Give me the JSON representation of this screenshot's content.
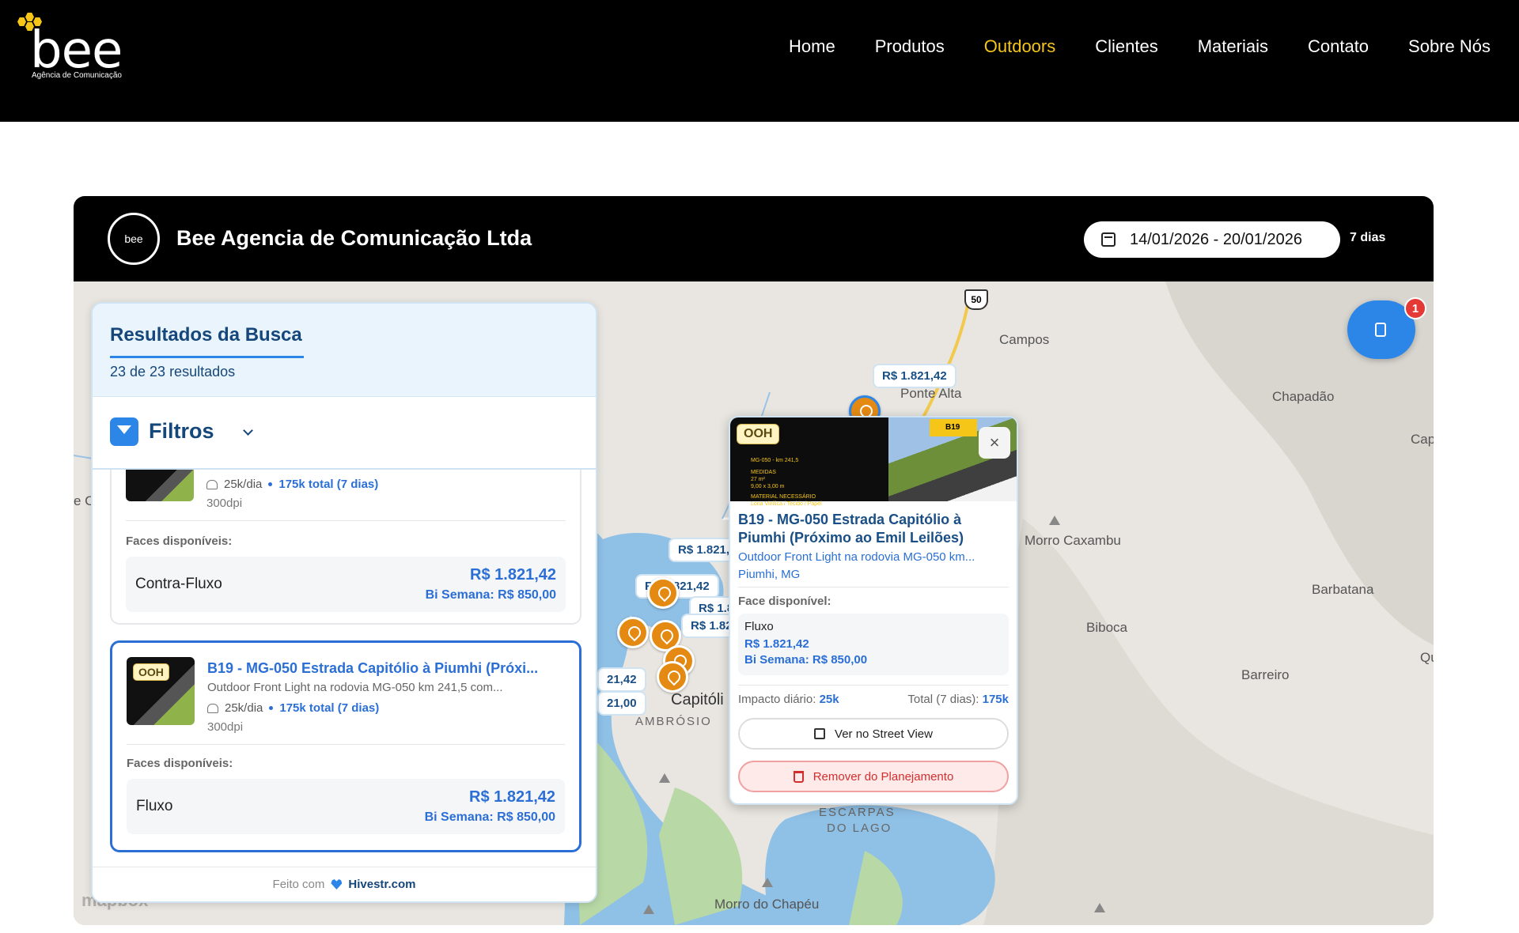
{
  "nav": {
    "brand_word": "bee",
    "brand_tagline": "Agência de Comunicação",
    "items": [
      {
        "label": "Home",
        "active": false
      },
      {
        "label": "Produtos",
        "active": false
      },
      {
        "label": "Outdoors",
        "active": true
      },
      {
        "label": "Clientes",
        "active": false
      },
      {
        "label": "Materiais",
        "active": false
      },
      {
        "label": "Contato",
        "active": false
      },
      {
        "label": "Sobre Nós",
        "active": false
      }
    ],
    "accent_color": "#f5c518"
  },
  "panel": {
    "logo_text": "bee",
    "company": "Bee Agencia de Comunicação Ltda",
    "date_range": "14/01/2026 - 20/01/2026",
    "days": "7 dias"
  },
  "map": {
    "places": {
      "campos": "Campos",
      "ponte_alta": "Ponte Alta",
      "chapadao": "Chapadão",
      "cap": "Cap",
      "morro_caxambu": "Morro Caxambu",
      "barbatana": "Barbatana",
      "biboca": "Biboca",
      "barreiro": "Barreiro",
      "qu": "Qu",
      "capitolio": "Capitóli",
      "ambrosio": "AMBRÓSIO",
      "escarpas": "ESCARPAS",
      "do_lago": "DO LAGO",
      "morro_chapeu": "Morro do Chapéu",
      "ec": "e C"
    },
    "highway": "50",
    "price_tags": [
      "R$ 1.821,42",
      "R$ 1.821,",
      "R$ 1.821,42",
      "R$ 1.8",
      "R$ 1.82",
      "21,42",
      "21,00"
    ],
    "attribution": "mapbox",
    "plan_badge_count": "1"
  },
  "results": {
    "title": "Resultados da Busca",
    "count": "23 de 23 resultados",
    "filters_label": "Filtros",
    "card1": {
      "audience": "25k/dia",
      "total": "175k total (7 dias)",
      "dpi": "300dpi",
      "faces_label": "Faces disponíveis:",
      "face_name": "Contra-Fluxo",
      "face_price": "R$ 1.821,42",
      "face_bi": "Bi Semana: R$ 850,00"
    },
    "card2": {
      "chip": "OOH",
      "title": "B19 - MG-050 Estrada Capitólio à Piumhi (Próxi...",
      "subtitle": "Outdoor Front Light na rodovia MG-050 km 241,5 com...",
      "audience": "25k/dia",
      "total": "175k total (7 dias)",
      "dpi": "300dpi",
      "faces_label": "Faces disponíveis:",
      "face_name": "Fluxo",
      "face_price": "R$ 1.821,42",
      "face_bi": "Bi Semana: R$ 850,00"
    },
    "footer_made": "Feito com",
    "footer_site": "Hivestr.com"
  },
  "popup": {
    "chip": "OOH",
    "title": "B19 - MG-050 Estrada Capitólio à Piumhi (Próximo ao Emil Leilões)",
    "subtitle": "Outdoor Front Light na rodovia MG-050 km...",
    "city": "Piumhi, MG",
    "face_label": "Face disponível:",
    "face_name": "Fluxo",
    "face_price": "R$ 1.821,42",
    "face_bi": "Bi Semana: R$ 850,00",
    "impact_label": "Impacto diário:",
    "impact_value": "25k",
    "total_label": "Total (7 dias):",
    "total_value": "175k",
    "street_view": "Ver no Street View",
    "remove": "Remover do Planejamento",
    "img_code": "B19",
    "img_meta": [
      "MG-050 - km 241,5",
      "MEDIDAS",
      "27 m²",
      "9,00 x 3,00 m",
      "MATERIAL NECESSÁRIO",
      "Lona Vinílica / Tecido / Papel"
    ]
  }
}
